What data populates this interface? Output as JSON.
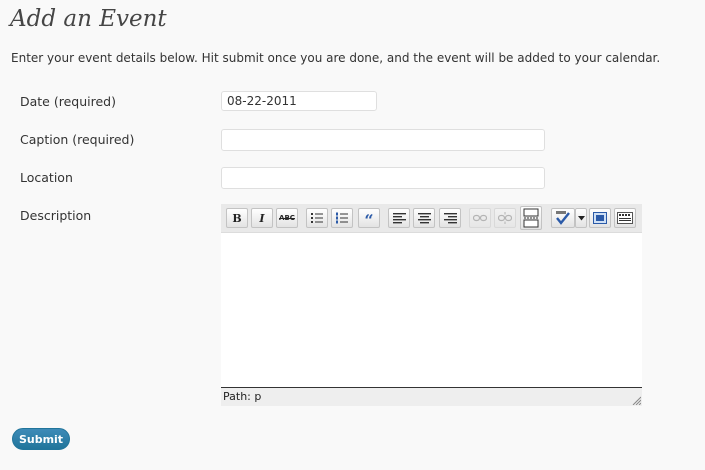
{
  "page": {
    "title": "Add an Event",
    "intro": "Enter your event details below. Hit submit once you are done, and the event will be added to your calendar."
  },
  "form": {
    "date": {
      "label": "Date (required)",
      "value": "08-22-2011"
    },
    "caption": {
      "label": "Caption (required)",
      "value": ""
    },
    "location": {
      "label": "Location",
      "value": ""
    },
    "description": {
      "label": "Description",
      "toolbar": [
        {
          "name": "bold",
          "icon": "bold-icon",
          "glyph": "B",
          "enabled": true
        },
        {
          "name": "italic",
          "icon": "italic-icon",
          "glyph": "I",
          "enabled": true
        },
        {
          "name": "strikethrough",
          "icon": "strikethrough-icon",
          "glyph": "ABC",
          "enabled": true
        },
        {
          "name": "bullet-list",
          "icon": "bullet-list-icon",
          "enabled": true
        },
        {
          "name": "numbered-list",
          "icon": "numbered-list-icon",
          "enabled": true
        },
        {
          "name": "blockquote",
          "icon": "blockquote-icon",
          "glyph": "“",
          "enabled": true
        },
        {
          "name": "align-left",
          "icon": "align-left-icon",
          "enabled": true
        },
        {
          "name": "align-center",
          "icon": "align-center-icon",
          "enabled": true
        },
        {
          "name": "align-right",
          "icon": "align-right-icon",
          "enabled": true
        },
        {
          "name": "insert-link",
          "icon": "link-icon",
          "enabled": false
        },
        {
          "name": "remove-link",
          "icon": "unlink-icon",
          "enabled": false
        },
        {
          "name": "insert-more",
          "icon": "more-tag-icon",
          "enabled": true
        },
        {
          "name": "spellcheck",
          "icon": "spellcheck-icon",
          "enabled": true
        },
        {
          "name": "spellcheck-options",
          "icon": "chevron-down-icon",
          "enabled": true
        },
        {
          "name": "fullscreen",
          "icon": "fullscreen-icon",
          "enabled": true
        },
        {
          "name": "kitchen-sink",
          "icon": "kitchen-sink-icon",
          "enabled": true
        }
      ],
      "content": "",
      "path_label": "Path: p"
    }
  },
  "submit_label": "Submit",
  "colors": {
    "background": "#f9f9f9",
    "title": "#464646",
    "submit_button": "#21759b",
    "toolbar": "#e9e9e9"
  }
}
